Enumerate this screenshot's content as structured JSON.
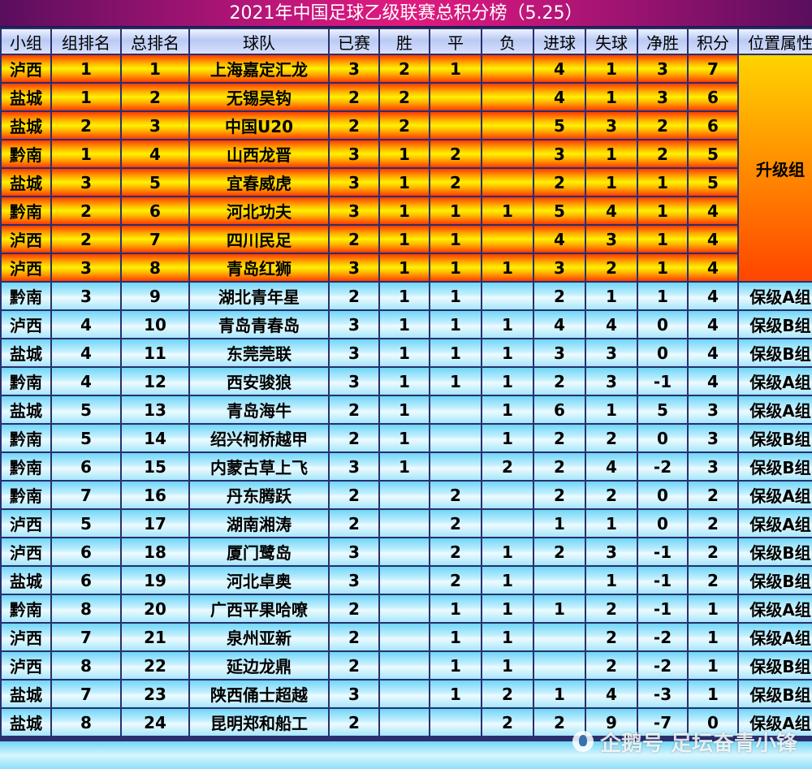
{
  "title": "2021年中国足球乙级联赛总积分榜（5.25）",
  "headers": [
    "小组",
    "组排名",
    "总排名",
    "球队",
    "已赛",
    "胜",
    "平",
    "负",
    "进球",
    "失球",
    "净胜",
    "积分",
    "位置属性"
  ],
  "promotion_label": "升级组",
  "watermark": "企鹅号 足坛奋青小锋",
  "promotion_rows": [
    [
      "泸西",
      "1",
      "1",
      "上海嘉定汇龙",
      "3",
      "2",
      "1",
      "",
      "4",
      "1",
      "3",
      "7"
    ],
    [
      "盐城",
      "1",
      "2",
      "无锡吴钩",
      "2",
      "2",
      "",
      "",
      "4",
      "1",
      "3",
      "6"
    ],
    [
      "盐城",
      "2",
      "3",
      "中国U20",
      "2",
      "2",
      "",
      "",
      "5",
      "3",
      "2",
      "6"
    ],
    [
      "黔南",
      "1",
      "4",
      "山西龙晋",
      "3",
      "1",
      "2",
      "",
      "3",
      "1",
      "2",
      "5"
    ],
    [
      "盐城",
      "3",
      "5",
      "宜春威虎",
      "3",
      "1",
      "2",
      "",
      "2",
      "1",
      "1",
      "5"
    ],
    [
      "黔南",
      "2",
      "6",
      "河北功夫",
      "3",
      "1",
      "1",
      "1",
      "5",
      "4",
      "1",
      "4"
    ],
    [
      "泸西",
      "2",
      "7",
      "四川民足",
      "2",
      "1",
      "1",
      "",
      "4",
      "3",
      "1",
      "4"
    ],
    [
      "泸西",
      "3",
      "8",
      "青岛红狮",
      "3",
      "1",
      "1",
      "1",
      "3",
      "2",
      "1",
      "4"
    ]
  ],
  "relegation_rows": [
    [
      "黔南",
      "3",
      "9",
      "湖北青年星",
      "2",
      "1",
      "1",
      "",
      "2",
      "1",
      "1",
      "4",
      "保级A组"
    ],
    [
      "泸西",
      "4",
      "10",
      "青岛青春岛",
      "3",
      "1",
      "1",
      "1",
      "4",
      "4",
      "0",
      "4",
      "保级B组"
    ],
    [
      "盐城",
      "4",
      "11",
      "东莞莞联",
      "3",
      "1",
      "1",
      "1",
      "3",
      "3",
      "0",
      "4",
      "保级B组"
    ],
    [
      "黔南",
      "4",
      "12",
      "西安骏狼",
      "3",
      "1",
      "1",
      "1",
      "2",
      "3",
      "-1",
      "4",
      "保级A组"
    ],
    [
      "盐城",
      "5",
      "13",
      "青岛海牛",
      "2",
      "1",
      "",
      "1",
      "6",
      "1",
      "5",
      "3",
      "保级A组"
    ],
    [
      "黔南",
      "5",
      "14",
      "绍兴柯桥越甲",
      "2",
      "1",
      "",
      "1",
      "2",
      "2",
      "0",
      "3",
      "保级B组"
    ],
    [
      "黔南",
      "6",
      "15",
      "内蒙古草上飞",
      "3",
      "1",
      "",
      "2",
      "2",
      "4",
      "-2",
      "3",
      "保级B组"
    ],
    [
      "黔南",
      "7",
      "16",
      "丹东腾跃",
      "2",
      "",
      "2",
      "",
      "2",
      "2",
      "0",
      "2",
      "保级A组"
    ],
    [
      "泸西",
      "5",
      "17",
      "湖南湘涛",
      "2",
      "",
      "2",
      "",
      "1",
      "1",
      "0",
      "2",
      "保级A组"
    ],
    [
      "泸西",
      "6",
      "18",
      "厦门鹭岛",
      "3",
      "",
      "2",
      "1",
      "2",
      "3",
      "-1",
      "2",
      "保级B组"
    ],
    [
      "盐城",
      "6",
      "19",
      "河北卓奥",
      "3",
      "",
      "2",
      "1",
      "",
      "1",
      "-1",
      "2",
      "保级B组"
    ],
    [
      "黔南",
      "8",
      "20",
      "广西平果哈嘹",
      "2",
      "",
      "1",
      "1",
      "1",
      "2",
      "-1",
      "1",
      "保级A组"
    ],
    [
      "泸西",
      "7",
      "21",
      "泉州亚新",
      "2",
      "",
      "1",
      "1",
      "",
      "2",
      "-2",
      "1",
      "保级A组"
    ],
    [
      "泸西",
      "8",
      "22",
      "延边龙鼎",
      "2",
      "",
      "1",
      "1",
      "",
      "2",
      "-2",
      "1",
      "保级B组"
    ],
    [
      "盐城",
      "7",
      "23",
      "陕西俑士超越",
      "3",
      "",
      "1",
      "2",
      "1",
      "4",
      "-3",
      "1",
      "保级B组"
    ],
    [
      "盐城",
      "8",
      "24",
      "昆明郑和船工",
      "2",
      "",
      "",
      "2",
      "2",
      "9",
      "-7",
      "0",
      "保级A组"
    ]
  ]
}
